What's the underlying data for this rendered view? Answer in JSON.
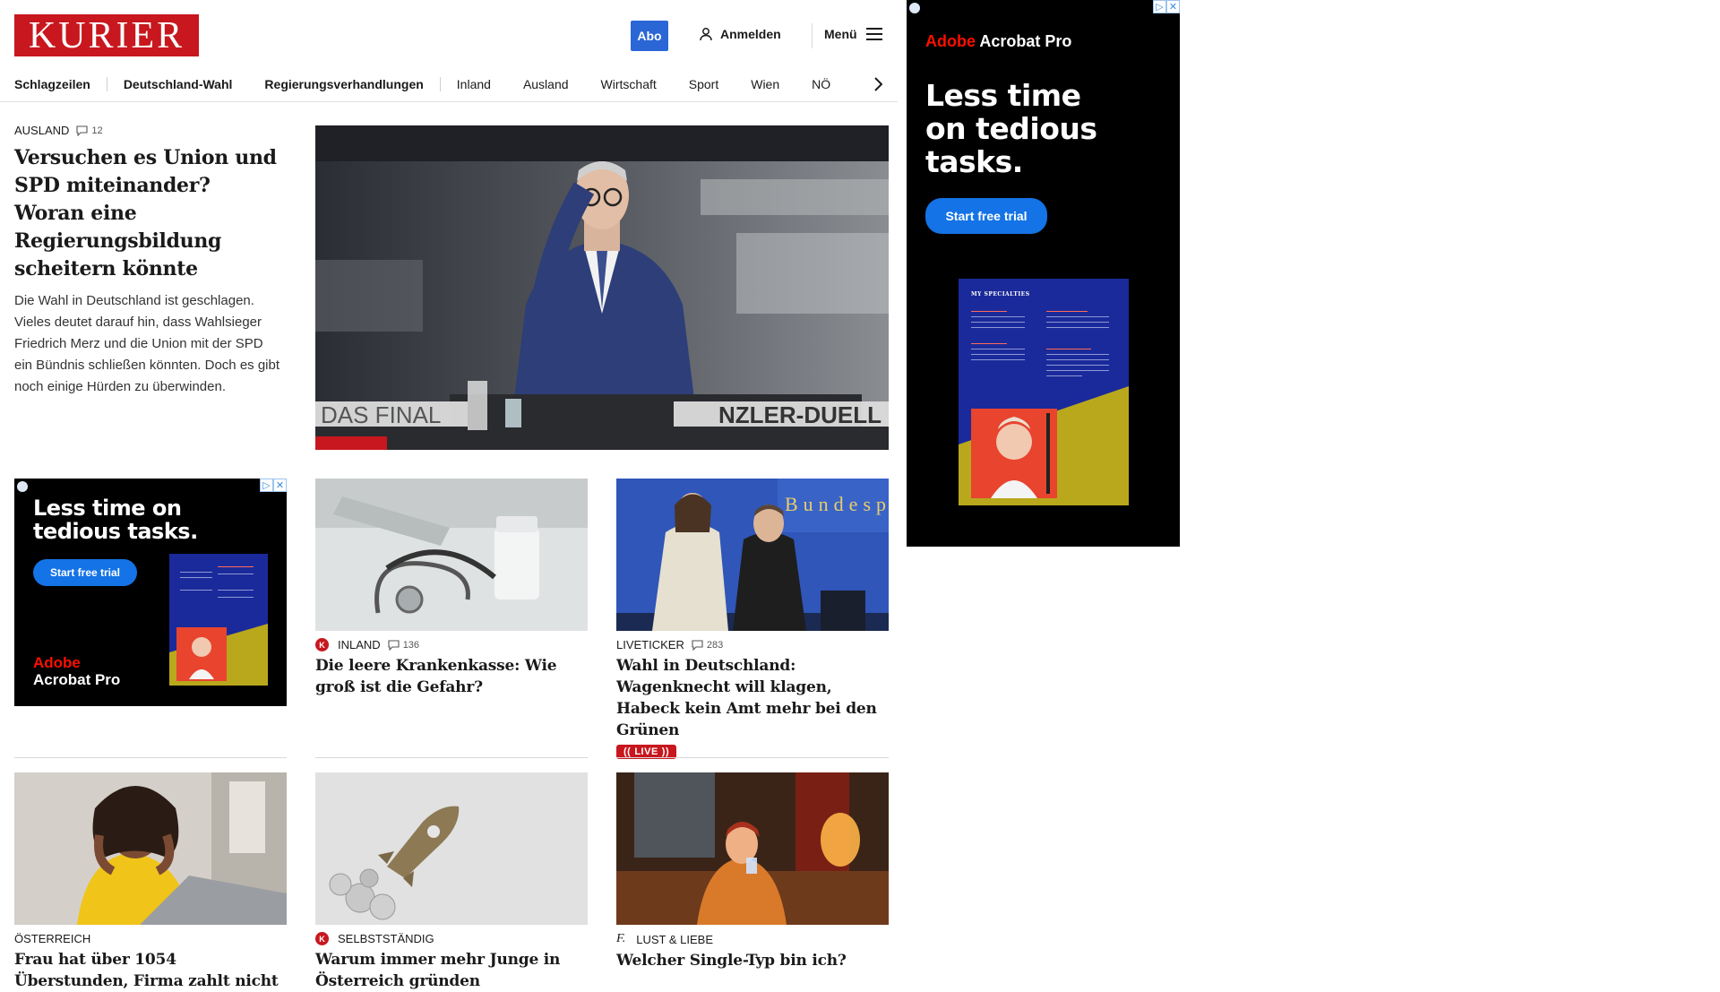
{
  "header": {
    "logo": "KURIER",
    "abo": "Abo",
    "login": "Anmelden",
    "menu": "Menü"
  },
  "nav": {
    "items": [
      "Schlagzeilen",
      "Deutschland-Wahl",
      "Regierungsverhandlungen",
      "Inland",
      "Ausland",
      "Wirtschaft",
      "Sport",
      "Wien",
      "NÖ"
    ]
  },
  "lead": {
    "category": "AUSLAND",
    "comments": "12",
    "title": "Versuchen es Union und SPD miteinander? Woran eine Regierungsbildung scheitern könnte",
    "teaser": "Die Wahl in Deutschland ist geschlagen. Vieles deutet darauf hin, dass Wahlsieger Friedrich Merz und die Union mit der SPD ein Bündnis schließen könnten. Doch es gibt noch einige Hürden zu überwinden.",
    "image_caption_left": "DAS FINAL",
    "image_caption_right": "NZLER-DUELL"
  },
  "cards": [
    {
      "category": "INLAND",
      "comments": "136",
      "title": "Die leere Krankenkasse: Wie groß ist die Gefahr?"
    },
    {
      "category": "LIVETICKER",
      "comments": "283",
      "title": "Wahl in Deutschland: Wagenknecht will klagen, Habeck kein Amt mehr bei den Grünen",
      "live": "LIVE",
      "image_text": "Bundesp"
    },
    {
      "category": "ÖSTERREICH",
      "title": "Frau hat über 1054 Überstunden, Firma zahlt nicht"
    },
    {
      "category": "SELBSTSTÄNDIG",
      "title": "Warum immer mehr Junge in Österreich gründen"
    },
    {
      "category": "LUST & LIEBE",
      "title": "Welcher Single-Typ bin ich?"
    }
  ],
  "ads": {
    "small": {
      "headline": "Less time on tedious tasks.",
      "button": "Start free trial",
      "brand_line1": "Adobe",
      "brand_line2": "Acrobat Pro"
    },
    "large": {
      "brand_adobe": "Adobe",
      "brand_product": "Acrobat Pro",
      "headline_1": "Less time",
      "headline_2": "on tedious",
      "headline_3": "tasks.",
      "button": "Start free trial",
      "brochure_title": "MY SPECIALTIES"
    }
  },
  "colors": {
    "brand_red": "#c8171e",
    "abo_blue": "#2b66d6",
    "adobe_red": "#fa0f00",
    "adobe_blue": "#1473e6",
    "brochure_blue": "#1a2a9a",
    "brochure_olive": "#b9a81c"
  },
  "icons": [
    "user-icon",
    "hamburger-icon",
    "chevron-right-icon",
    "comment-icon",
    "kurier-k-icon",
    "live-icon",
    "adchoices-icon",
    "close-ad-icon"
  ]
}
